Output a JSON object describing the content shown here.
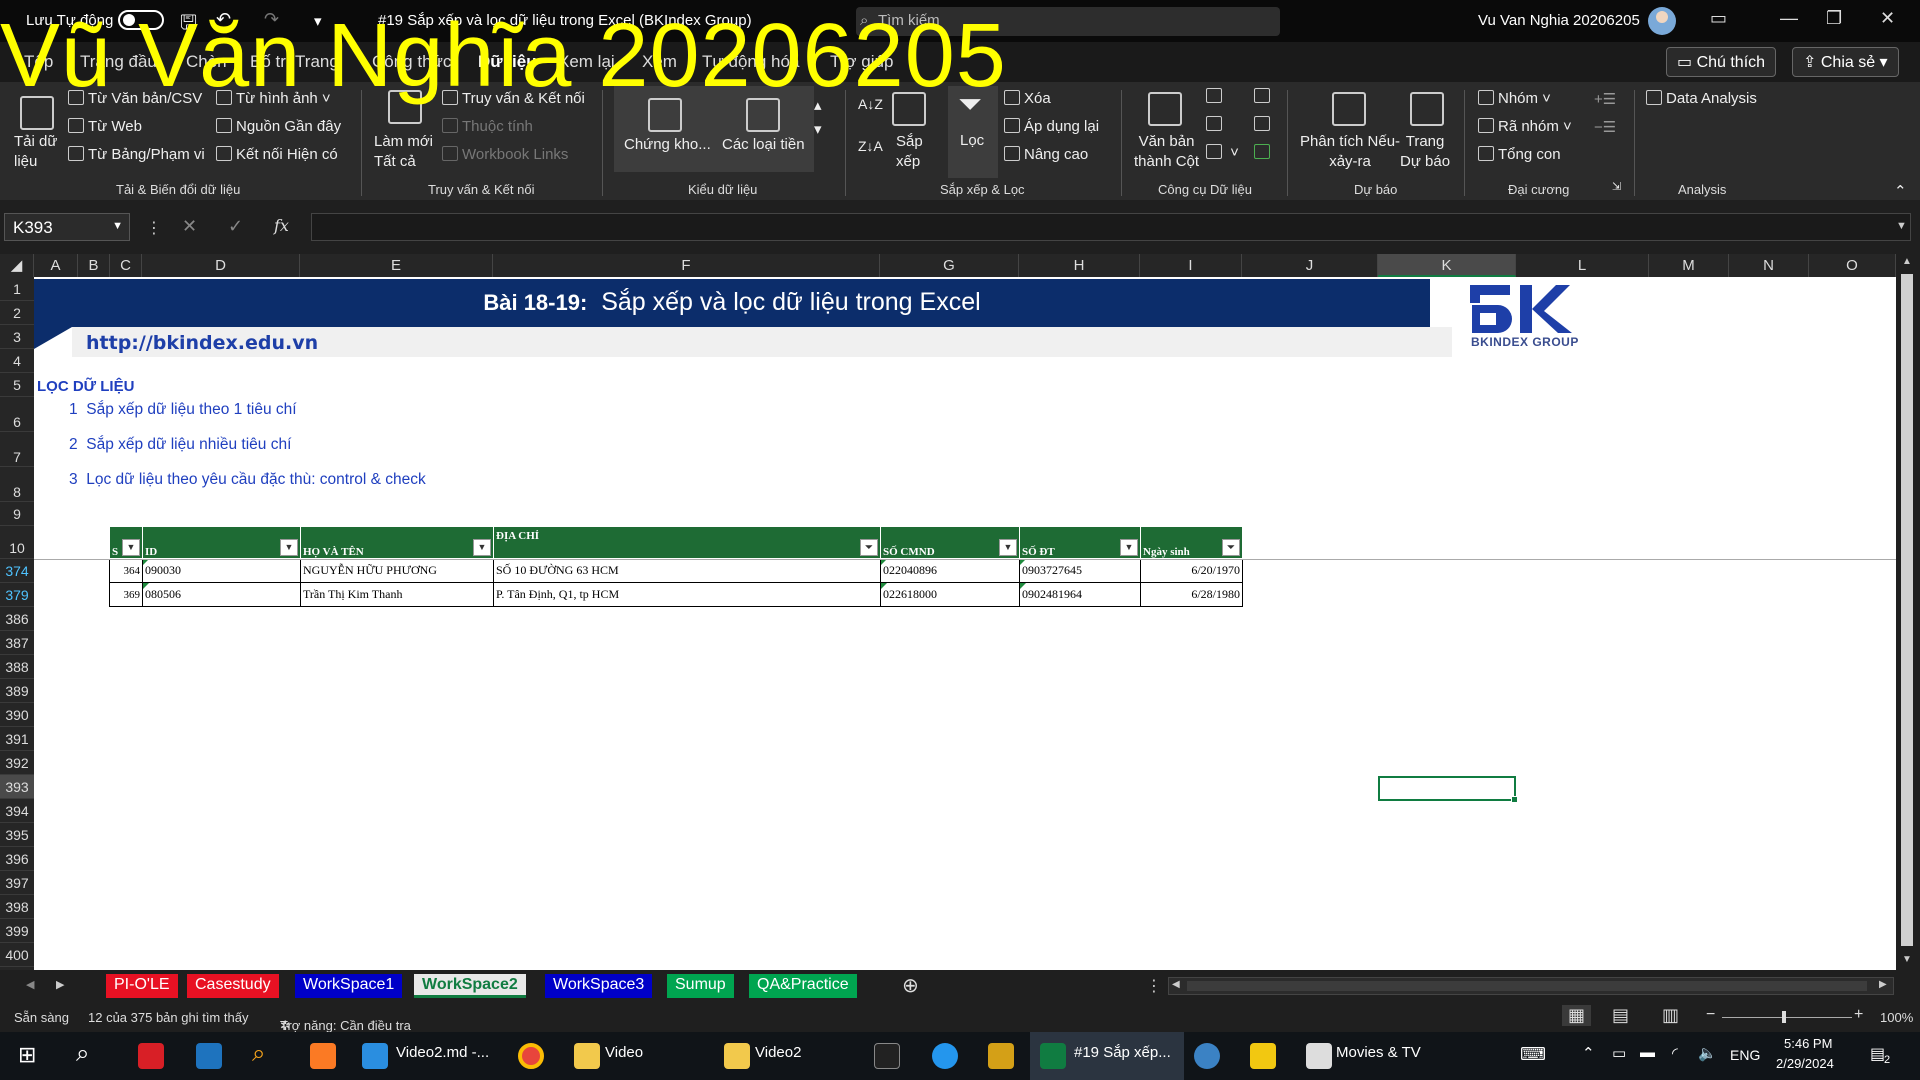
{
  "titlebar": {
    "autosave_label": "Lưu Tự động",
    "doc_title": "#19 Sắp xếp và lọc dữ liệu trong Excel (BKIndex Group)",
    "search_placeholder": "Tìm kiếm",
    "user_name": "Vu Van Nghia 20206205"
  },
  "watermark": "Vũ Văn Nghĩa 20206205",
  "tabs": [
    "Tệp",
    "Trang đầu",
    "Chèn",
    "Bố trí Trang",
    "Công thức",
    "Dữ liệu",
    "Xem lại",
    "Xem",
    "Tự động hóa",
    "Trợ giúp"
  ],
  "header_buttons": {
    "comments": "Chú thích",
    "share": "Chia sẻ"
  },
  "ribbon": {
    "get_data": "Tải dữ\nliệu",
    "from_text": "Từ Văn bản/CSV",
    "from_web": "Từ Web",
    "from_table": "Từ Bảng/Phạm vi",
    "from_picture": "Từ hình ảnh",
    "recent_sources": "Nguồn Gần đây",
    "existing_conn": "Kết nối Hiện có",
    "group_get": "Tải & Biến đổi dữ liệu",
    "refresh_all": "Làm mới\nTất cả",
    "queries_conn": "Truy vấn & Kết nối",
    "properties": "Thuộc tính",
    "workbook_links": "Workbook Links",
    "group_queries": "Truy vấn & Kết nối",
    "stocks": "Chứng kho...",
    "currencies": "Các loại tiền",
    "group_types": "Kiểu dữ liệu",
    "sort": "Sắp\nxếp",
    "filter": "Lọc",
    "clear": "Xóa",
    "reapply": "Áp dụng lại",
    "advanced": "Nâng cao",
    "group_sort": "Sắp xếp & Lọc",
    "text_to_columns": "Văn bản\nthành Cột",
    "group_tools": "Công cụ Dữ liệu",
    "whatif": "Phân tích Nếu-\nxảy-ra",
    "forecast_sheet": "Trang\nDự báo",
    "group_forecast": "Dự báo",
    "group_outline_items": [
      "Nhóm",
      "Rã nhóm",
      "Tổng con"
    ],
    "group_outline": "Đại cương",
    "data_analysis": "Data Analysis",
    "group_analysis": "Analysis"
  },
  "formula_bar": {
    "name_box": "K393",
    "formula": ""
  },
  "columns": [
    "A",
    "B",
    "C",
    "D",
    "E",
    "F",
    "G",
    "H",
    "I",
    "J",
    "K",
    "L",
    "M",
    "N",
    "O"
  ],
  "rows": [
    "1",
    "2",
    "3",
    "4",
    "5",
    "6",
    "7",
    "8",
    "9",
    "10",
    "374",
    "379",
    "386",
    "387",
    "388",
    "389",
    "390",
    "391",
    "392",
    "393",
    "394",
    "395",
    "396",
    "397",
    "398",
    "399",
    "400"
  ],
  "sheet": {
    "banner_bold": "Bài 18-19:",
    "banner_text": "Sắp xếp và lọc dữ liệu trong Excel",
    "url": "http://bkindex.edu.vn",
    "logo_text": "BKINDEX GROUP",
    "section": "LỌC DỮ LIỆU",
    "items": [
      {
        "num": "1",
        "text": "Sắp xếp dữ liệu theo 1 tiêu chí"
      },
      {
        "num": "2",
        "text": "Sắp xếp dữ liệu nhiều tiêu chí"
      },
      {
        "num": "3",
        "text": "Lọc dữ liệu theo yêu cầu đặc thù: control & check"
      }
    ],
    "table": {
      "headers": [
        "S",
        "ID",
        "HỌ VÀ TÊN",
        "ĐỊA CHỈ",
        "SỐ CMND",
        "SỐ ĐT",
        "Ngày sinh"
      ],
      "rows": [
        [
          "364",
          "090030",
          "NGUYỄN HỮU PHƯƠNG",
          "SỐ 10 ĐƯỜNG 63 HCM",
          "022040896",
          "0903727645",
          "6/20/1970"
        ],
        [
          "369",
          "080506",
          "Trần Thị Kim Thanh",
          "P. Tân Định, Q1, tp HCM",
          "022618000",
          "0902481964",
          "6/28/1980"
        ]
      ]
    }
  },
  "sheet_tabs": [
    {
      "name": "PI-O'LE",
      "color": "#e81123"
    },
    {
      "name": "Casestudy",
      "color": "#e81123"
    },
    {
      "name": "WorkSpace1",
      "color": "#0000c8"
    },
    {
      "name": "WorkSpace2",
      "color": "#ffffff"
    },
    {
      "name": "WorkSpace3",
      "color": "#0000c8"
    },
    {
      "name": "Sumup",
      "color": "#00a550"
    },
    {
      "name": "QA&Practice",
      "color": "#00a550"
    }
  ],
  "status": {
    "ready": "Sẵn sàng",
    "records": "12 của 375 bản ghi tìm thấy",
    "accessibility": "Trợ năng: Cần điều tra",
    "zoom": "100%"
  },
  "taskbar": {
    "vscode": "Video2.md -...",
    "folder1": "Video",
    "folder2": "Video2",
    "excel": "#19 Sắp xếp...",
    "movies": "Movies & TV",
    "lang": "ENG",
    "time": "5:46 PM",
    "date": "2/29/2024",
    "notif": "2"
  }
}
